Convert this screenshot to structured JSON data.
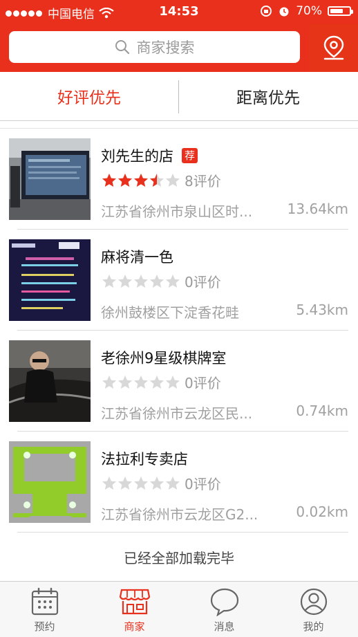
{
  "status_bar": {
    "carrier": "中国电信",
    "time": "14:53",
    "battery": "70%",
    "battery_level": 0.7
  },
  "search": {
    "placeholder": "商家搜索",
    "location_icon": "location-pin-icon"
  },
  "sort_tabs": [
    {
      "label": "好评优先",
      "active": true
    },
    {
      "label": "距离优先",
      "active": false
    }
  ],
  "colors": {
    "accent": "#e8301c",
    "star_filled": "#e8301c",
    "star_empty": "#d8d8d8",
    "muted_text": "#a0a0a0"
  },
  "shops": [
    {
      "name": "刘先生的店",
      "badge": "荐",
      "rating": 3.5,
      "reviews": "8评价",
      "address": "江苏省徐州市泉山区时...",
      "distance": "13.64km"
    },
    {
      "name": "麻将清一色",
      "badge": "",
      "rating": 0,
      "reviews": "0评价",
      "address": "徐州鼓楼区下淀香花畦",
      "distance": "5.43km"
    },
    {
      "name": "老徐州9星级棋牌室",
      "badge": "",
      "rating": 0,
      "reviews": "0评价",
      "address": "江苏省徐州市云龙区民...",
      "distance": "0.74km"
    },
    {
      "name": "法拉利专卖店",
      "badge": "",
      "rating": 0,
      "reviews": "0评价",
      "address": "江苏省徐州市云龙区G2...",
      "distance": "0.02km"
    }
  ],
  "list_footer": "已经全部加载完毕",
  "tab_bar": [
    {
      "label": "预约",
      "icon": "calendar-icon",
      "active": false
    },
    {
      "label": "商家",
      "icon": "storefront-icon",
      "active": true
    },
    {
      "label": "消息",
      "icon": "chat-bubble-icon",
      "active": false
    },
    {
      "label": "我的",
      "icon": "user-profile-icon",
      "active": false
    }
  ]
}
